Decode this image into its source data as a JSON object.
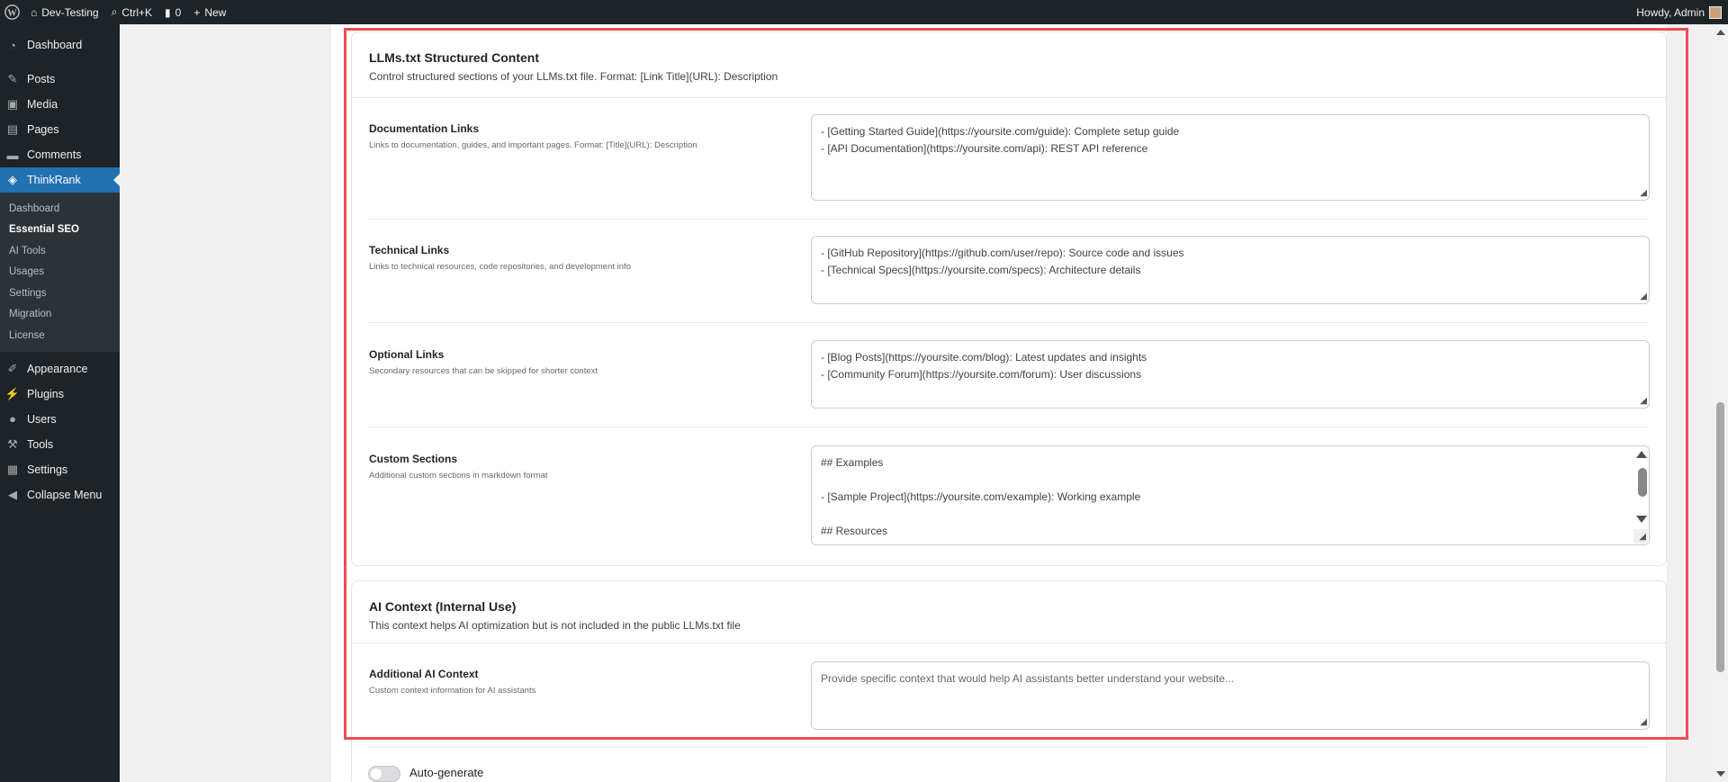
{
  "admin_bar": {
    "site_name": "Dev-Testing",
    "search_shortcut": "Ctrl+K",
    "comments_count": "0",
    "new_label": "New",
    "greeting": "Howdy, Admin"
  },
  "sidebar": {
    "items_top": [
      {
        "label": "Dashboard",
        "icon": "dashboard-icon"
      },
      {
        "label": "Posts",
        "icon": "pin-icon"
      },
      {
        "label": "Media",
        "icon": "media-icon"
      },
      {
        "label": "Pages",
        "icon": "pages-icon"
      },
      {
        "label": "Comments",
        "icon": "comment-icon"
      },
      {
        "label": "ThinkRank",
        "icon": "thinkrank-icon"
      }
    ],
    "submenu": [
      "Dashboard",
      "Essential SEO",
      "AI Tools",
      "Usages",
      "Settings",
      "Migration",
      "License"
    ],
    "items_bottom": [
      {
        "label": "Appearance",
        "icon": "brush-icon"
      },
      {
        "label": "Plugins",
        "icon": "plug-icon"
      },
      {
        "label": "Users",
        "icon": "user-icon"
      },
      {
        "label": "Tools",
        "icon": "wrench-icon"
      },
      {
        "label": "Settings",
        "icon": "settings-icon"
      },
      {
        "label": "Collapse Menu",
        "icon": "collapse-icon"
      }
    ]
  },
  "structured": {
    "title": "LLMs.txt Structured Content",
    "description": "Control structured sections of your LLMs.txt file. Format: [Link Title](URL): Description",
    "rows": [
      {
        "label": "Documentation Links",
        "hint": "Links to documentation, guides, and important pages. Format: [Title](URL): Description",
        "lines": [
          "- [Getting Started Guide](https://yoursite.com/guide): Complete setup guide",
          "- [API Documentation](https://yoursite.com/api): REST API reference"
        ]
      },
      {
        "label": "Technical Links",
        "hint": "Links to technical resources, code repositories, and development info",
        "lines": [
          "- [GitHub Repository](https://github.com/user/repo): Source code and issues",
          "- [Technical Specs](https://yoursite.com/specs): Architecture details"
        ]
      },
      {
        "label": "Optional Links",
        "hint": "Secondary resources that can be skipped for shorter context",
        "lines": [
          "- [Blog Posts](https://yoursite.com/blog): Latest updates and insights",
          "- [Community Forum](https://yoursite.com/forum): User discussions"
        ]
      },
      {
        "label": "Custom Sections",
        "hint": "Additional custom sections in markdown format",
        "lines": [
          "## Examples",
          "",
          "- [Sample Project](https://yoursite.com/example): Working example",
          "",
          "## Resources"
        ]
      }
    ]
  },
  "ai_context": {
    "title": "AI Context (Internal Use)",
    "description": "This context helps AI optimization but is not included in the public LLMs.txt file",
    "field_label": "Additional AI Context",
    "field_hint": "Custom context information for AI assistants",
    "placeholder": "Provide specific context that would help AI assistants better understand your website..."
  },
  "auto_generate": {
    "label": "Auto-generate",
    "enabled": false
  },
  "colors": {
    "highlight": "#ea4d55",
    "accent": "#2271b1",
    "admin_bg": "#1d2327"
  }
}
